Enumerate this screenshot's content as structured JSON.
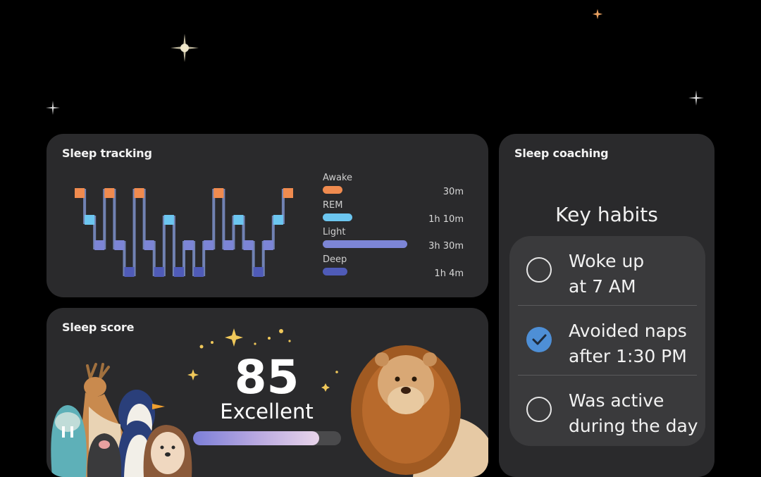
{
  "colors": {
    "awake": "#f08b4f",
    "rem": "#6cc6f0",
    "light": "#7c85d6",
    "deep": "#4f5bb8",
    "check_on": "#4e8fd6"
  },
  "sleep_tracking": {
    "title": "Sleep tracking",
    "legend": [
      {
        "label": "Awake",
        "duration": "30m",
        "fill": 0.14
      },
      {
        "label": "REM",
        "duration": "1h 10m",
        "fill": 0.36
      },
      {
        "label": "Light",
        "duration": "3h 30m",
        "fill": 1.0
      },
      {
        "label": "Deep",
        "duration": "1h 4m",
        "fill": 0.3
      }
    ],
    "hypnogram_stages": [
      "awake",
      "rem",
      "light",
      "awake",
      "light",
      "deep",
      "awake",
      "light",
      "deep",
      "rem",
      "deep",
      "light",
      "deep",
      "light",
      "awake",
      "light",
      "rem",
      "light",
      "deep",
      "light",
      "rem",
      "awake"
    ]
  },
  "sleep_score": {
    "title": "Sleep score",
    "score": "85",
    "rating": "Excellent",
    "progress": 0.85
  },
  "sleep_coaching": {
    "title": "Sleep coaching",
    "key_habits_title": "Key habits",
    "habits": [
      {
        "text": "Woke up at 7 AM",
        "line1": "Woke up",
        "line2": "at 7 AM",
        "checked": false
      },
      {
        "text": "Avoided naps after 1:30 PM",
        "line1": "Avoided naps",
        "line2": "after 1:30 PM",
        "checked": true
      },
      {
        "text": "Was active during the day",
        "line1": "Was active",
        "line2": "during the day",
        "checked": false
      }
    ]
  }
}
